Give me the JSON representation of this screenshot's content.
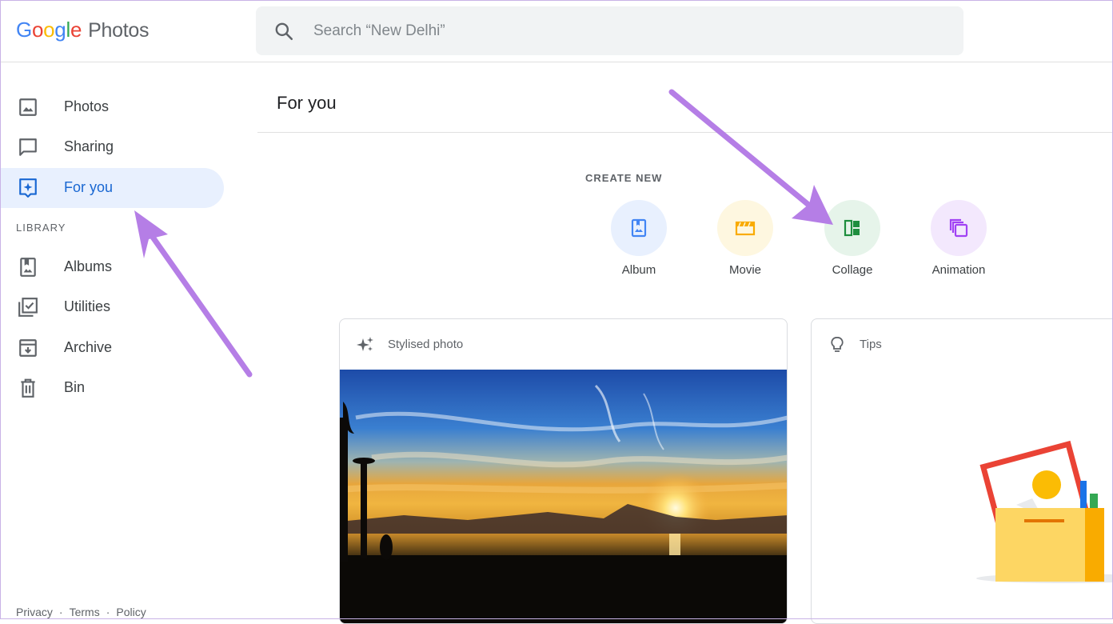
{
  "header": {
    "logo_letters": [
      {
        "ch": "G",
        "color": "#4285F4"
      },
      {
        "ch": "o",
        "color": "#EA4335"
      },
      {
        "ch": "o",
        "color": "#FBBC05"
      },
      {
        "ch": "g",
        "color": "#4285F4"
      },
      {
        "ch": "l",
        "color": "#34A853"
      },
      {
        "ch": "e",
        "color": "#EA4335"
      }
    ],
    "product_name": "Photos",
    "search_placeholder": "Search “New Delhi”",
    "search_icon": "search-icon"
  },
  "sidebar": {
    "items": [
      {
        "label": "Photos",
        "icon": "photo-icon"
      },
      {
        "label": "Sharing",
        "icon": "chat-bubble-icon"
      },
      {
        "label": "For you",
        "icon": "assistant-icon",
        "active": true
      }
    ],
    "library_heading": "LIBRARY",
    "library_items": [
      {
        "label": "Albums",
        "icon": "album-icon"
      },
      {
        "label": "Utilities",
        "icon": "utilities-icon"
      },
      {
        "label": "Archive",
        "icon": "archive-icon"
      },
      {
        "label": "Bin",
        "icon": "trash-icon"
      }
    ],
    "footer": {
      "privacy": "Privacy",
      "sep1": "·",
      "terms": "Terms",
      "sep2": "·",
      "policy": "Policy"
    }
  },
  "main": {
    "title": "For you",
    "create_new_heading": "CREATE NEW",
    "create_options": [
      {
        "label": "Album",
        "icon": "album-icon",
        "bg": "#e8f0fe",
        "fg": "#4285f4"
      },
      {
        "label": "Movie",
        "icon": "movie-icon",
        "bg": "#fef7e0",
        "fg": "#f9ab00"
      },
      {
        "label": "Collage",
        "icon": "collage-icon",
        "bg": "#e6f4ea",
        "fg": "#1e8e3e"
      },
      {
        "label": "Animation",
        "icon": "animation-icon",
        "bg": "#f3e8fd",
        "fg": "#a142f4"
      }
    ],
    "cards": [
      {
        "title": "Stylised photo",
        "icon": "sparkle-icon"
      },
      {
        "title": "Tips",
        "icon": "lightbulb-icon"
      }
    ]
  },
  "colors": {
    "accent": "#1967d2",
    "active_bg": "#e8f0fe",
    "annotation_arrow": "#b57ee6"
  }
}
